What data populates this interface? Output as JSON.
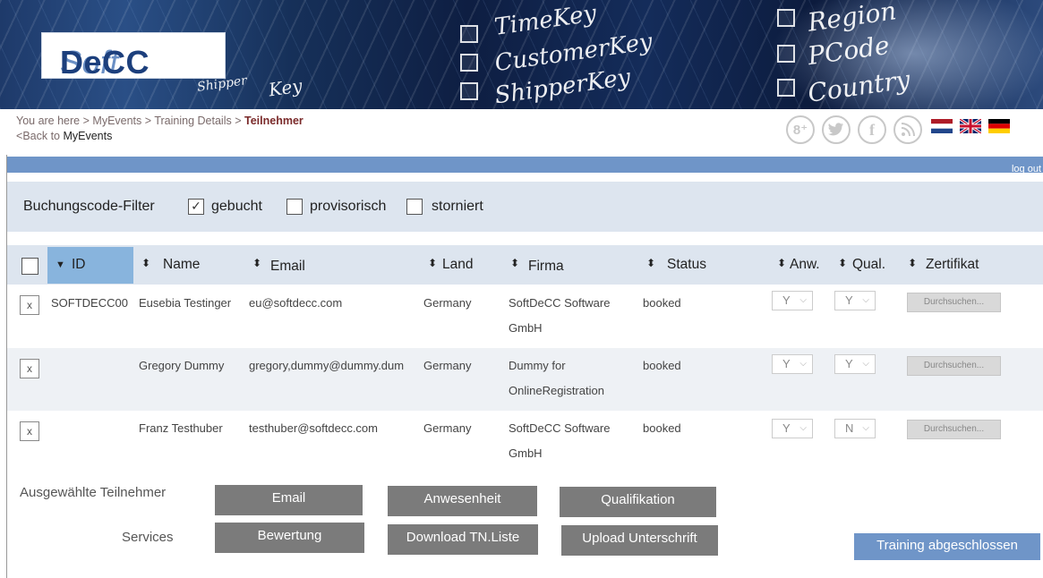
{
  "logo": {
    "soft": "Soft",
    "decc": "DeCC"
  },
  "banner_words": [
    "TimeKey",
    "CustomerKey",
    "ShipperKey",
    "Region",
    "PCode",
    "Country",
    "Shipper",
    "Key"
  ],
  "breadcrumb": {
    "prefix": "You are here",
    "items": [
      "MyEvents",
      "Training Details"
    ],
    "current": "Teilnehmer",
    "back_prefix": "Back to",
    "back_link": "MyEvents"
  },
  "social": [
    {
      "icon": "google-plus-icon",
      "glyph": "8⁺"
    },
    {
      "icon": "twitter-icon",
      "glyph": "🐦"
    },
    {
      "icon": "facebook-icon",
      "glyph": "f"
    },
    {
      "icon": "rss-icon",
      "glyph": "◝"
    }
  ],
  "languages": [
    {
      "icon": "flag-netherlands-icon",
      "colors": [
        "#ae1c28",
        "#ffffff",
        "#21468b"
      ]
    },
    {
      "icon": "flag-uk-icon",
      "colors": [
        "#012169",
        "#ffffff",
        "#c8102e"
      ]
    },
    {
      "icon": "flag-germany-icon",
      "colors": [
        "#000000",
        "#dd0000",
        "#ffce00"
      ]
    }
  ],
  "topbar": {
    "logout": "log out"
  },
  "filter": {
    "label": "Buchungscode-Filter",
    "options": [
      {
        "label": "gebucht",
        "checked": true
      },
      {
        "label": "provisorisch",
        "checked": false
      },
      {
        "label": "storniert",
        "checked": false
      }
    ]
  },
  "table": {
    "columns": [
      "ID",
      "Name",
      "Email",
      "Land",
      "Firma",
      "Status",
      "Anw.",
      "Qual.",
      "Zertifikat"
    ],
    "sort_asc_glyph": "▼",
    "sort_glyph": "⬍",
    "rows": [
      {
        "select": "x",
        "id": "SOFTDECC00",
        "name": "Eusebia Testinger",
        "email": "eu@softdecc.com",
        "land": "Germany",
        "firma_1": "SoftDeCC Software",
        "firma_2": "GmbH",
        "status": "booked",
        "anw": "Y",
        "qual": "Y",
        "zertifikat": "Durchsuchen..."
      },
      {
        "select": "x",
        "id": "",
        "name": "Gregory Dummy",
        "email": "gregory,dummy@dummy.dum",
        "land": "Germany",
        "firma_1": "Dummy for",
        "firma_2": "OnlineRegistration",
        "status": "booked",
        "anw": "Y",
        "qual": "Y",
        "zertifikat": "Durchsuchen..."
      },
      {
        "select": "x",
        "id": "",
        "name": "Franz Testhuber",
        "email": "testhuber@softdecc.com",
        "land": "Germany",
        "firma_1": "SoftDeCC Software",
        "firma_2": "GmbH",
        "status": "booked",
        "anw": "Y",
        "qual": "N",
        "zertifikat": "Durchsuchen..."
      }
    ]
  },
  "actions": {
    "selected_label": "Ausgewählte Teilnehmer",
    "services_label": "Services",
    "email": "Email",
    "attendance": "Anwesenheit",
    "qualification": "Qualifikation",
    "rating": "Bewertung",
    "download": "Download TN.Liste",
    "upload": "Upload Unterschrift",
    "done": "Training abgeschlossen"
  },
  "colors": {
    "accent": "#6f95c8",
    "header_row": "#dde5ef",
    "sorted_column": "#88b4dd",
    "button_gray": "#7b7b7b"
  }
}
